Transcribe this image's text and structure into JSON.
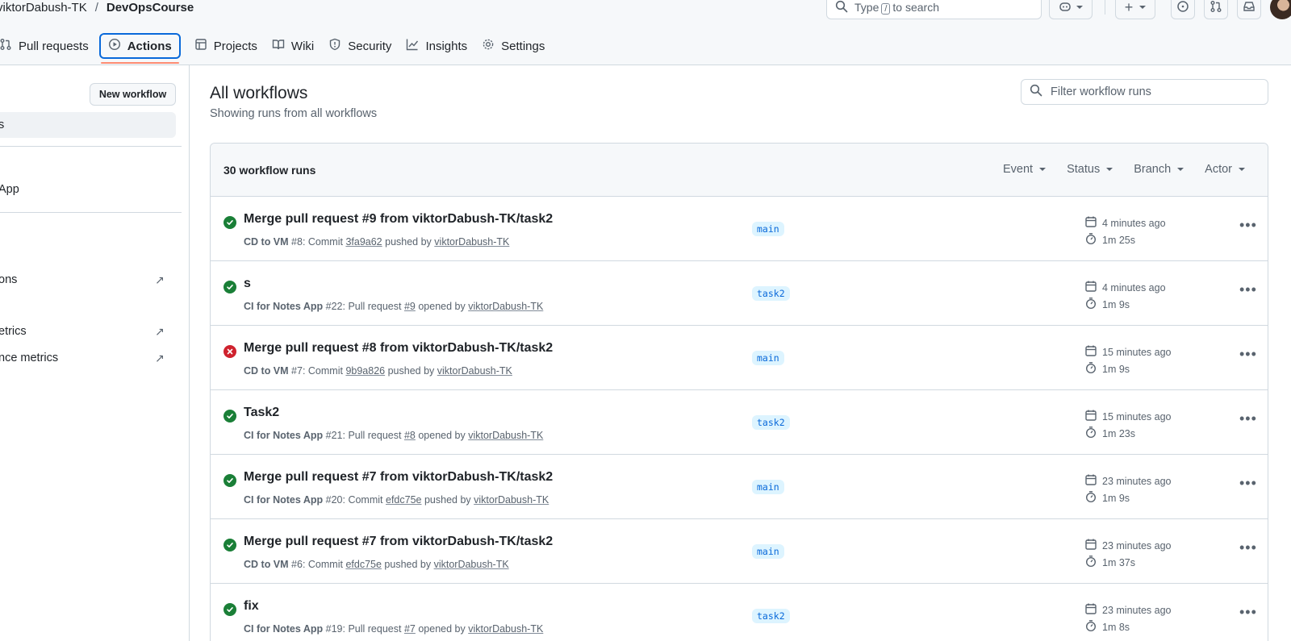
{
  "header": {
    "owner": "viktorDabush-TK",
    "separator": "/",
    "repo": "DevOpsCourse",
    "search_prefix": "Type",
    "search_key": "/",
    "search_suffix": "to search"
  },
  "tabs": [
    {
      "label": "Pull requests",
      "icon": "git-pull-request-icon"
    },
    {
      "label": "Actions",
      "icon": "play-circle-icon",
      "selected": true
    },
    {
      "label": "Projects",
      "icon": "table-icon"
    },
    {
      "label": "Wiki",
      "icon": "book-icon"
    },
    {
      "label": "Security",
      "icon": "shield-icon"
    },
    {
      "label": "Insights",
      "icon": "graph-icon"
    },
    {
      "label": "Settings",
      "icon": "gear-icon"
    }
  ],
  "sidebar": {
    "new_workflow": "New workflow",
    "items": [
      "s",
      "App",
      "ons",
      "etrics",
      "nce metrics"
    ]
  },
  "main": {
    "title": "All workflows",
    "subtitle": "Showing runs from all workflows",
    "filter_placeholder": "Filter workflow runs",
    "runs_count": "30 workflow runs",
    "filters": [
      "Event",
      "Status",
      "Branch",
      "Actor"
    ]
  },
  "runs": [
    {
      "title": "Merge pull request #9 from viktorDabush-TK/task2",
      "status": "success",
      "workflow": "CD to VM",
      "run": "#8",
      "action": "Commit",
      "ref": "3fa9a62",
      "verb": "pushed by",
      "user": "viktorDabush-TK",
      "branch": "main",
      "when": "4 minutes ago",
      "duration": "1m 25s"
    },
    {
      "title": "s",
      "status": "success",
      "workflow": "CI for Notes App",
      "run": "#22",
      "action": "Pull request",
      "ref": "#9",
      "verb": "opened by",
      "user": "viktorDabush-TK",
      "branch": "task2",
      "when": "4 minutes ago",
      "duration": "1m 9s"
    },
    {
      "title": "Merge pull request #8 from viktorDabush-TK/task2",
      "status": "failure",
      "workflow": "CD to VM",
      "run": "#7",
      "action": "Commit",
      "ref": "9b9a826",
      "verb": "pushed by",
      "user": "viktorDabush-TK",
      "branch": "main",
      "when": "15 minutes ago",
      "duration": "1m 9s"
    },
    {
      "title": "Task2",
      "status": "success",
      "workflow": "CI for Notes App",
      "run": "#21",
      "action": "Pull request",
      "ref": "#8",
      "verb": "opened by",
      "user": "viktorDabush-TK",
      "branch": "task2",
      "when": "15 minutes ago",
      "duration": "1m 23s"
    },
    {
      "title": "Merge pull request #7 from viktorDabush-TK/task2",
      "status": "success",
      "workflow": "CI for Notes App",
      "run": "#20",
      "action": "Commit",
      "ref": "efdc75e",
      "verb": "pushed by",
      "user": "viktorDabush-TK",
      "branch": "main",
      "when": "23 minutes ago",
      "duration": "1m 9s"
    },
    {
      "title": "Merge pull request #7 from viktorDabush-TK/task2",
      "status": "success",
      "workflow": "CD to VM",
      "run": "#6",
      "action": "Commit",
      "ref": "efdc75e",
      "verb": "pushed by",
      "user": "viktorDabush-TK",
      "branch": "main",
      "when": "23 minutes ago",
      "duration": "1m 37s"
    },
    {
      "title": "fix",
      "status": "success",
      "workflow": "CI for Notes App",
      "run": "#19",
      "action": "Pull request",
      "ref": "#7",
      "verb": "opened by",
      "user": "viktorDabush-TK",
      "branch": "task2",
      "when": "23 minutes ago",
      "duration": "1m 8s"
    }
  ]
}
